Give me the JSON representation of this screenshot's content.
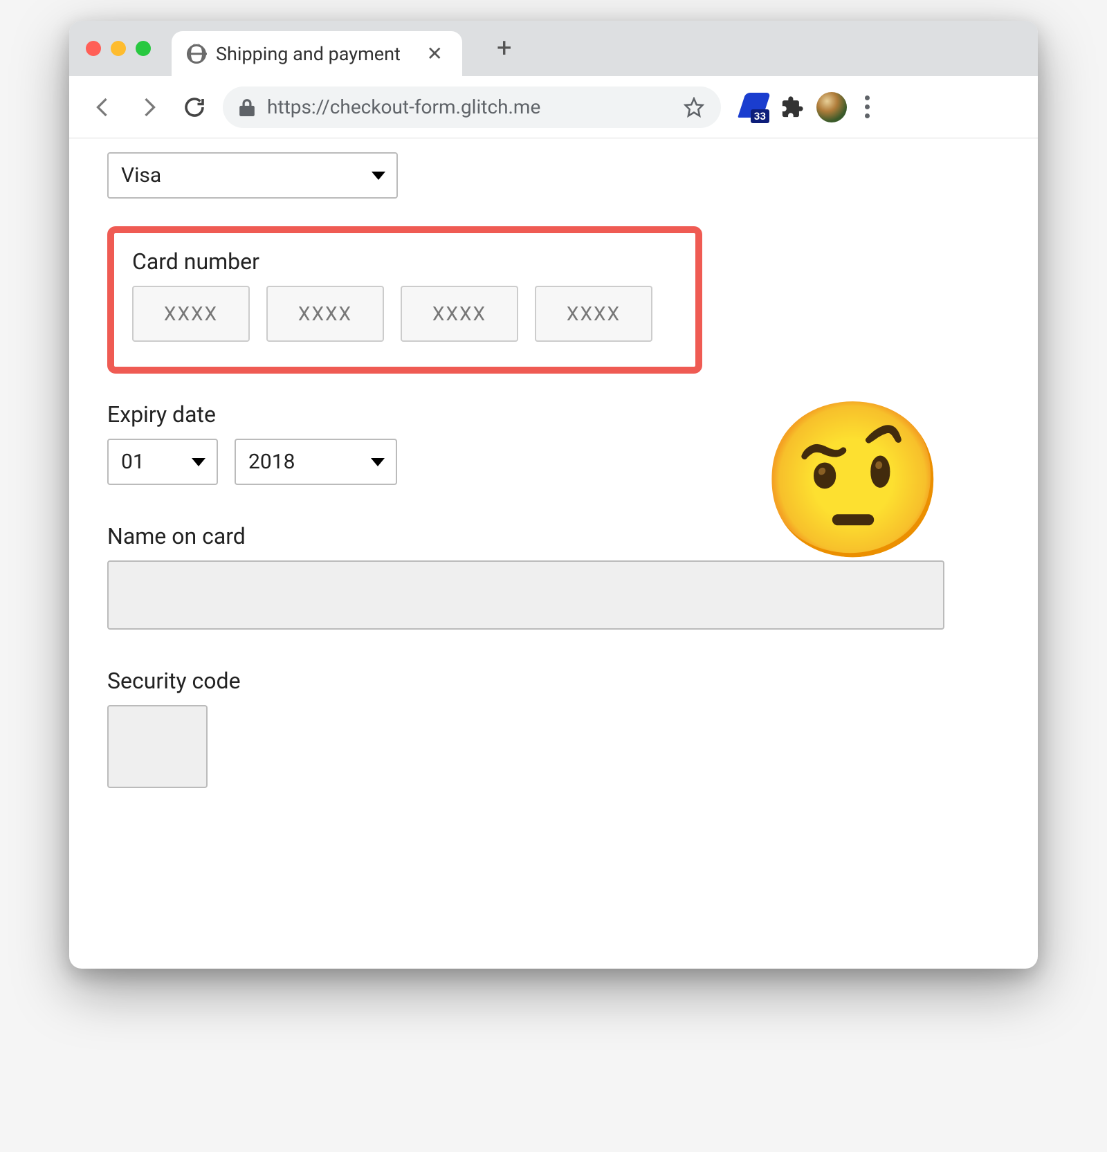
{
  "browser": {
    "tab_title": "Shipping and payment",
    "url": "https://checkout-form.glitch.me",
    "extension_badge": "33"
  },
  "form": {
    "card_type": {
      "selected": "Visa"
    },
    "card_number": {
      "label": "Card number",
      "placeholder_segments": [
        "XXXX",
        "XXXX",
        "XXXX",
        "XXXX"
      ]
    },
    "expiry": {
      "label": "Expiry date",
      "month": "01",
      "year": "2018"
    },
    "name": {
      "label": "Name on card",
      "value": ""
    },
    "cvv": {
      "label": "Security code",
      "value": ""
    }
  },
  "annotation": {
    "emoji": "🤨"
  }
}
